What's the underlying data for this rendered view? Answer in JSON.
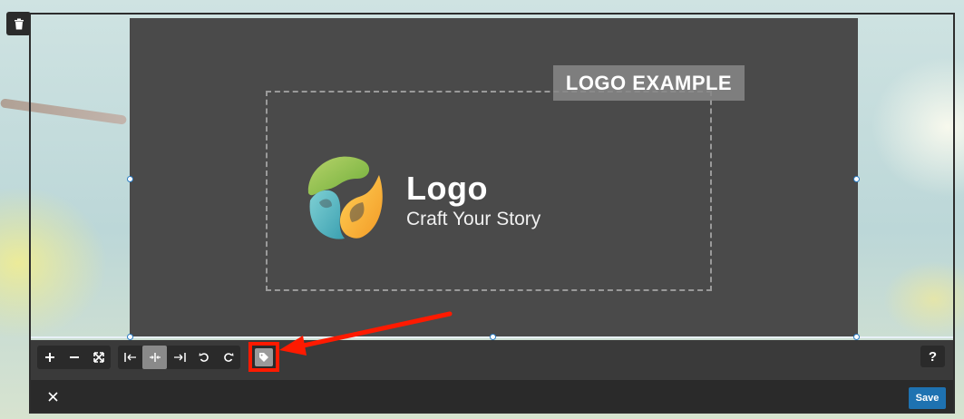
{
  "canvas": {
    "badge_text": "LOGO EXAMPLE",
    "logo_title": "Logo",
    "logo_tagline": "Craft Your Story"
  },
  "toolbar": {
    "zoom_group": [
      {
        "name": "zoom-in-icon",
        "glyph": "+"
      },
      {
        "name": "zoom-out-icon",
        "glyph": "−"
      },
      {
        "name": "fit-to-screen-icon",
        "glyph": "⤡"
      }
    ],
    "align_group": [
      {
        "name": "align-left-icon",
        "glyph": "|←",
        "active": false
      },
      {
        "name": "align-center-icon",
        "glyph": "→|←",
        "active": true
      },
      {
        "name": "align-right-icon",
        "glyph": "→|",
        "active": false
      },
      {
        "name": "rotate-left-icon",
        "glyph": "↺",
        "active": false
      },
      {
        "name": "rotate-right-icon",
        "glyph": "↻",
        "active": false
      }
    ],
    "help_label": "?"
  },
  "footer": {
    "close_glyph": "✕",
    "save_label": "Save"
  },
  "colors": {
    "accent": "#1e72b1",
    "highlight": "#ff1a00",
    "canvas_bg": "#4a4a4a"
  }
}
